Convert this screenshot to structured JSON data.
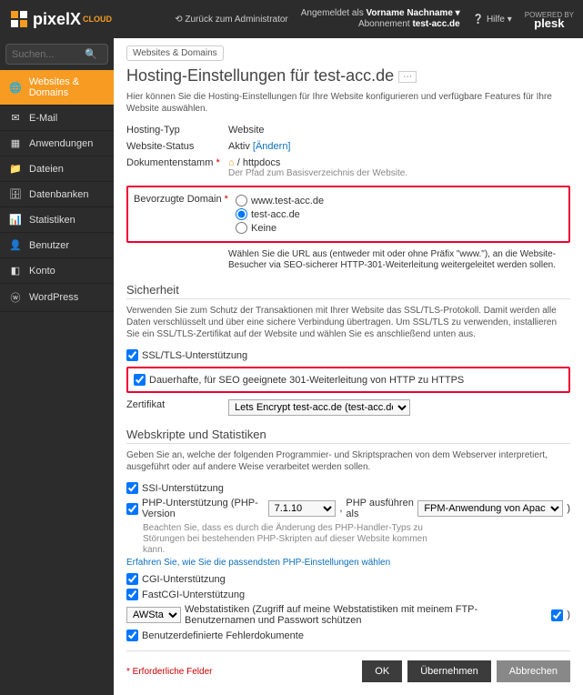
{
  "brand": {
    "name": "pixelX",
    "sub": "CLOUD"
  },
  "top": {
    "back": "Zurück zum Administrator",
    "logged_as_lbl": "Angemeldet als",
    "username": "Vorname Nachname",
    "sub_lbl": "Abonnement",
    "sub_val": "test-acc.de",
    "help": "Hilfe",
    "powered": "POWERED BY",
    "plesk": "plesk"
  },
  "search": {
    "placeholder": "Suchen..."
  },
  "nav": [
    {
      "label": "Websites & Domains",
      "icon": "🌐"
    },
    {
      "label": "E-Mail",
      "icon": "✉"
    },
    {
      "label": "Anwendungen",
      "icon": "▦"
    },
    {
      "label": "Dateien",
      "icon": "📁"
    },
    {
      "label": "Datenbanken",
      "icon": "🗄"
    },
    {
      "label": "Statistiken",
      "icon": "📊"
    },
    {
      "label": "Benutzer",
      "icon": "👤"
    },
    {
      "label": "Konto",
      "icon": "◧"
    },
    {
      "label": "WordPress",
      "icon": "ⓦ"
    }
  ],
  "breadcrumb": "Websites & Domains",
  "title": "Hosting-Einstellungen für test-acc.de",
  "intro": "Hier können Sie die Hosting-Einstellungen für Ihre Website konfigurieren und verfügbare Features für Ihre Website auswählen.",
  "rows": {
    "type_lbl": "Hosting-Typ",
    "type_val": "Website",
    "status_lbl": "Website-Status",
    "status_val": "Aktiv",
    "status_change": "[Ändern]",
    "docroot_lbl": "Dokumentenstamm",
    "docroot_val": "/ httpdocs",
    "docroot_hint": "Der Pfad zum Basisverzeichnis der Website.",
    "pref_lbl": "Bevorzugte Domain",
    "pref_opts": [
      "www.test-acc.de",
      "test-acc.de",
      "Keine"
    ],
    "pref_hint": "Wählen Sie die URL aus (entweder mit oder ohne Präfix \"www.\"), an die Website-Besucher via SEO-sicherer HTTP-301-Weiterleitung weitergeleitet werden sollen."
  },
  "sec": {
    "heading": "Sicherheit",
    "desc": "Verwenden Sie zum Schutz der Transaktionen mit Ihrer Website das SSL/TLS-Protokoll. Damit werden alle Daten verschlüsselt und über eine sichere Verbindung übertragen. Um SSL/TLS zu verwenden, installieren Sie ein SSL/TLS-Zertifikat auf der Website und wählen Sie es anschließend unten aus.",
    "ssl_chk": "SSL/TLS-Unterstützung",
    "redirect_chk": "Dauerhafte, für SEO geeignete 301-Weiterleitung von HTTP zu HTTPS",
    "cert_lbl": "Zertifikat",
    "cert_val": "Lets Encrypt test-acc.de (test-acc.de)"
  },
  "scripts": {
    "heading": "Webskripte und Statistiken",
    "desc": "Geben Sie an, welche der folgenden Programmier- und Skriptsprachen von dem Webserver interpretiert, ausgeführt oder auf andere Weise verarbeitet werden sollen.",
    "ssi": "SSI-Unterstützung",
    "php_chk": "PHP-Unterstützung (PHP-Version",
    "php_ver": "7.1.10",
    "php_run_lbl": "PHP ausführen als",
    "php_run_val": "FPM-Anwendung von Apache bedient",
    "php_hint": "Beachten Sie, dass es durch die Änderung des PHP-Handler-Typs zu Störungen bei bestehenden PHP-Skripten auf dieser Website kommen kann.",
    "php_link": "Erfahren Sie, wie Sie die passendsten PHP-Einstellungen wählen",
    "cgi": "CGI-Unterstützung",
    "fcgi": "FastCGI-Unterstützung",
    "awstats": "AWStats",
    "webstats": "Webstatistiken (Zugriff auf meine Webstatistiken mit meinem FTP-Benutzernamen und Passwort schützen",
    "errdocs": "Benutzerdefinierte Fehlerdokumente"
  },
  "footer": {
    "required": "* Erforderliche Felder",
    "ok": "OK",
    "apply": "Übernehmen",
    "cancel": "Abbrechen"
  }
}
